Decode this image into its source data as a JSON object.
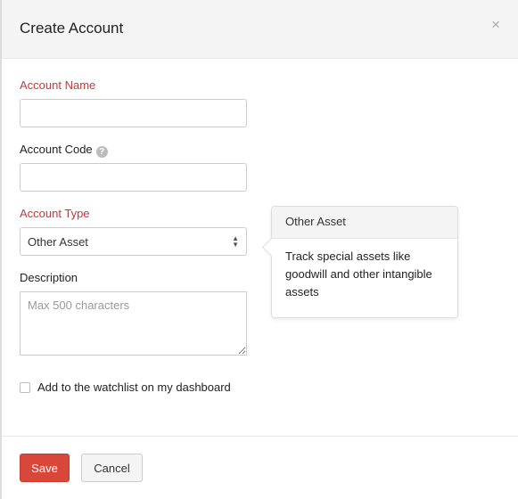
{
  "modal": {
    "title": "Create Account",
    "close_icon": "close-icon"
  },
  "form": {
    "account_name": {
      "label": "Account Name",
      "value": ""
    },
    "account_code": {
      "label": "Account Code",
      "value": "",
      "help_icon": "?"
    },
    "account_type": {
      "label": "Account Type",
      "value": "Other Asset"
    },
    "description": {
      "label": "Description",
      "placeholder": "Max 500 characters"
    },
    "watchlist": {
      "label": "Add to the watchlist on my dashboard",
      "checked": false
    }
  },
  "popover": {
    "title": "Other Asset",
    "body": "Track special assets like goodwill and other intangible assets"
  },
  "footer": {
    "save_label": "Save",
    "cancel_label": "Cancel"
  },
  "colors": {
    "required": "#c0393b",
    "save": "#d9473a"
  }
}
